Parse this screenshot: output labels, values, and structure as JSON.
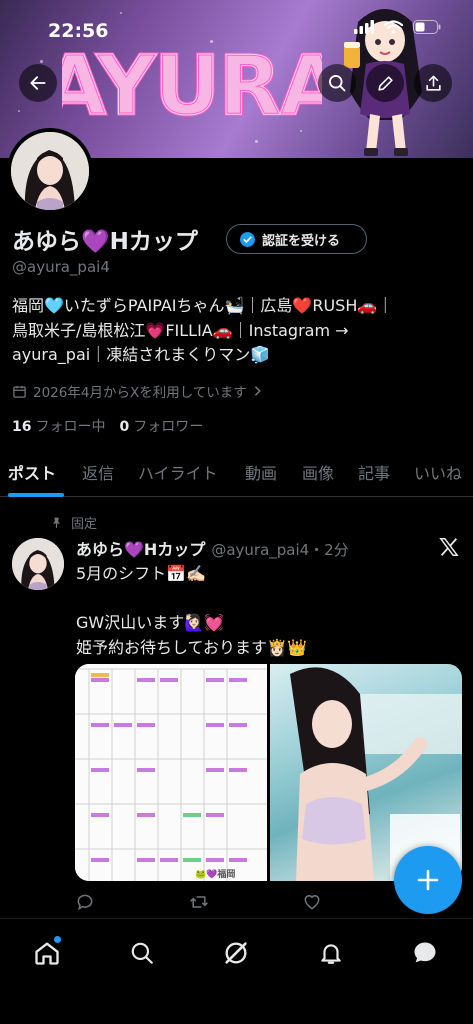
{
  "status_bar": {
    "time": "22:56"
  },
  "banner": {
    "logo_text": "AYURA"
  },
  "profile": {
    "display_name": "あゆら💜Hカップ",
    "verify_label": "認証を受ける",
    "handle": "@ayura_pai4",
    "bio_line1": "福岡🩵いたずらPAIPAIちゃん🛀｜広島❤️RUSH🚗｜",
    "bio_line2": "鳥取米子/島根松江💗FILLIA🚗｜Instagram →",
    "bio_line3": "ayura_pai｜凍結されまくりマン🧊",
    "joined": "2026年4月からXを利用しています",
    "following_count": "16",
    "following_label": "フォロー中",
    "followers_count": "0",
    "followers_label": "フォロワー"
  },
  "tabs": [
    "ポスト",
    "返信",
    "ハイライト",
    "動画",
    "画像",
    "記事",
    "いいね"
  ],
  "post": {
    "pinned_label": "固定",
    "name": "あゆら💜Hカップ",
    "handle_time": "@ayura_pai4・2分",
    "text": "5月のシフト📅✍🏻\n\nGW沢山います🙋🏻‍♀️💓\n姫予約お待ちしております👸🏻👑",
    "calendar_footer": "🐸💜福岡"
  },
  "colors": {
    "accent": "#1d9bf0",
    "background": "#000000",
    "muted": "#71767b"
  },
  "icons": [
    "back-arrow-icon",
    "search-icon",
    "edit-icon",
    "share-icon",
    "verified-badge-icon",
    "calendar-icon",
    "pin-icon",
    "x-logo-icon",
    "reply-icon",
    "repost-icon",
    "like-icon",
    "views-icon",
    "plus-icon",
    "home-icon",
    "search-nav-icon",
    "grok-icon",
    "notifications-icon",
    "messages-icon"
  ]
}
